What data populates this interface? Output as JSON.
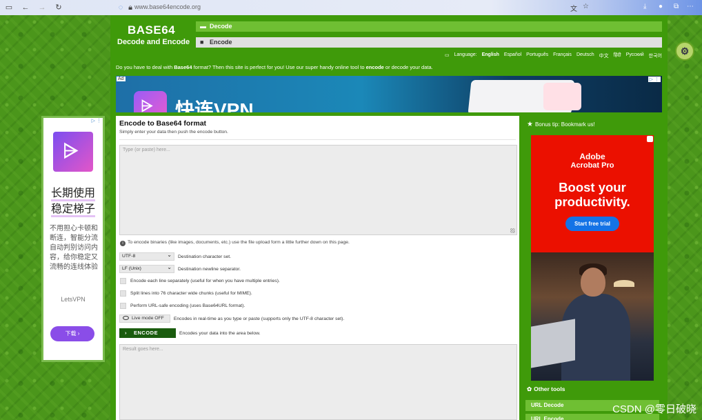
{
  "browser": {
    "url": "www.base64encode.org",
    "icons": [
      "sidebar-icon",
      "back-icon",
      "forward-icon",
      "reload-icon",
      "shield-icon",
      "lock-icon",
      "translate-icon",
      "star-icon",
      "download-icon",
      "profile-icon",
      "extensions-icon",
      "menu-icon"
    ]
  },
  "header": {
    "logo_title": "BASE64",
    "logo_subtitle": "Decode and Encode",
    "nav": [
      {
        "label": "Decode"
      },
      {
        "label": "Encode"
      }
    ]
  },
  "language_bar": {
    "prefix": "Language:",
    "active": "English",
    "others": [
      "Español",
      "Português",
      "Français",
      "Deutsch",
      "中文",
      "हिंदी",
      "Русский",
      "한국어"
    ]
  },
  "tagline": {
    "part1": "Do you have to deal with ",
    "strong1": "Base64",
    "part2": " format? Then this site is perfect for you! Use our super handy online tool to ",
    "strong2": "encode",
    "part3": " or decode your data."
  },
  "top_ad": {
    "label": "Ad",
    "brand_text": "快连VPN",
    "chip": "▷ ⋮"
  },
  "encode_panel": {
    "title": "Encode to Base64 format",
    "subtitle": "Simply enter your data then push the encode button.",
    "input_placeholder": "Type (or paste) here...",
    "info_text": "To encode binaries (like images, documents, etc.) use the file upload form a little further down on this page.",
    "charset": {
      "value": "UTF-8",
      "label": "Destination character set."
    },
    "newline": {
      "value": "LF (Unix)",
      "label": "Destination newline separator."
    },
    "options": [
      {
        "label": "Encode each line separately (useful for when you have multiple entries).",
        "checked": false
      },
      {
        "label": "Split lines into 76 character wide chunks (useful for MIME).",
        "checked": false
      },
      {
        "label": "Perform URL-safe encoding (uses Base64URL format).",
        "checked": false
      }
    ],
    "live_mode": {
      "button": "Live mode OFF",
      "label": "Encodes in real-time as you type or paste (supports only the UTF-8 character set)."
    },
    "encode_button": {
      "label": "ENCODE",
      "description": "Encodes your data into the area below."
    },
    "result_placeholder": "Result goes here..."
  },
  "sidebar": {
    "bonus_tip": "Bonus tip: Bookmark us!",
    "adobe_ad": {
      "brand": "Adobe",
      "product": "Acrobat Pro",
      "headline_1": "Boost your",
      "headline_2": "productivity.",
      "cta": "Start free trial"
    },
    "other_tools_title": "Other tools",
    "tools": [
      {
        "label": "URL Decode"
      },
      {
        "label": "URL Encode"
      }
    ]
  },
  "left_ad": {
    "chip": "▷ ⋮",
    "headline_1": "长期使用",
    "headline_2": "稳定梯子",
    "body": "不用担心卡顿和断连，智能分流自动判别访问内容，给你稳定又流畅的连线体验",
    "brand": "LetsVPN",
    "cta": "下载 ›"
  },
  "watermark": "CSDN @零日破晓",
  "colors": {
    "page_green": "#3f9a0a",
    "nav_green": "#6fbf33",
    "button_dark_green": "#1a5c0e",
    "adobe_red": "#eb1000"
  }
}
